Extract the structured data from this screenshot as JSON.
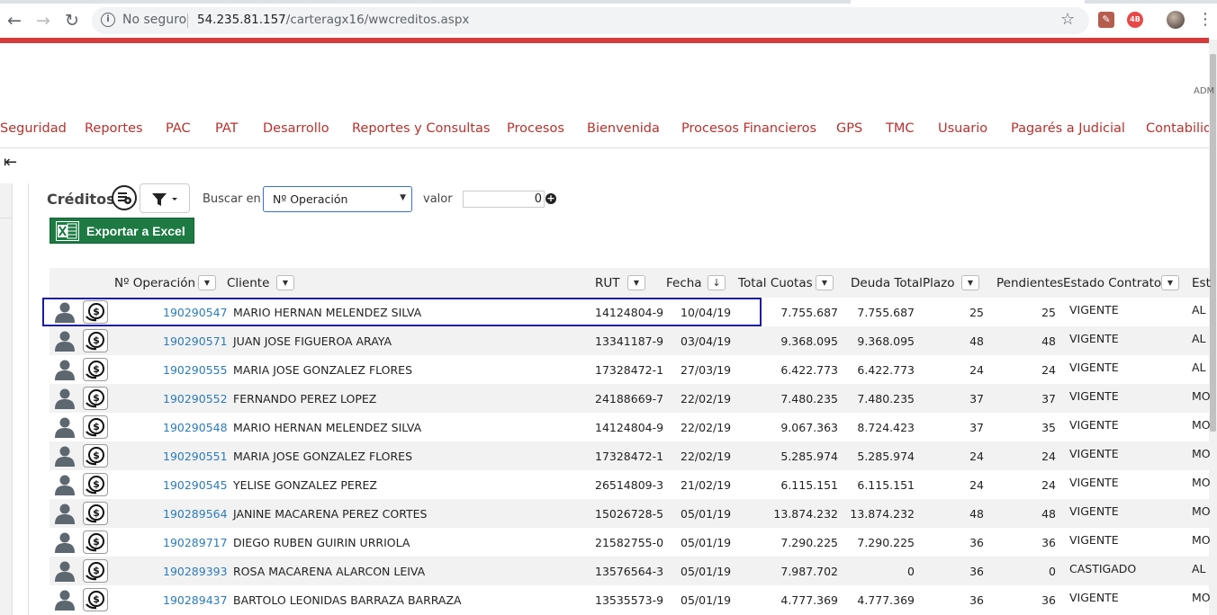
{
  "browser": {
    "insecure_label": "No seguro",
    "url_host": "54.235.81.157",
    "url_path": "/carteragx16/wwcreditos.aspx",
    "ext_badge": "4B"
  },
  "header": {
    "user_label": "ADM"
  },
  "menu": [
    "Seguridad",
    "Reportes",
    "PAC",
    "PAT",
    "Desarrollo",
    "Reportes y Consultas",
    "Procesos",
    "Bienvenida",
    "Procesos Financieros",
    "GPS",
    "TMC",
    "Usuario",
    "Pagarés a Judicial",
    "Contabilid"
  ],
  "toolbar": {
    "title": "Créditos",
    "buscar_label": "Buscar en",
    "buscar_selected": "Nº Operación",
    "valor_label": "valor",
    "valor_value": "0",
    "excel_label": "Exportar a Excel"
  },
  "table": {
    "headers": {
      "operacion": "Nº Operación",
      "cliente": "Cliente",
      "rut": "RUT",
      "fecha": "Fecha",
      "total_cuotas": "Total Cuotas",
      "deuda_total": "Deuda Total",
      "plazo": "Plazo",
      "pendientes": "Pendientes",
      "estado": "Estado Contrato",
      "est": "Est"
    },
    "rows": [
      {
        "op": "190290547",
        "cliente": "MARIO HERNAN MELENDEZ SILVA",
        "rut": "14124804-9",
        "fecha": "10/04/19",
        "total": "7.755.687",
        "deuda": "7.755.687",
        "plazo": "25",
        "pend": "25",
        "estado": "VIGENTE",
        "est": "AL"
      },
      {
        "op": "190290571",
        "cliente": "JUAN JOSE FIGUEROA ARAYA",
        "rut": "13341187-9",
        "fecha": "03/04/19",
        "total": "9.368.095",
        "deuda": "9.368.095",
        "plazo": "48",
        "pend": "48",
        "estado": "VIGENTE",
        "est": "AL"
      },
      {
        "op": "190290555",
        "cliente": "MARIA JOSE GONZALEZ FLORES",
        "rut": "17328472-1",
        "fecha": "27/03/19",
        "total": "6.422.773",
        "deuda": "6.422.773",
        "plazo": "24",
        "pend": "24",
        "estado": "VIGENTE",
        "est": "AL"
      },
      {
        "op": "190290552",
        "cliente": "FERNANDO PEREZ LOPEZ",
        "rut": "24188669-7",
        "fecha": "22/02/19",
        "total": "7.480.235",
        "deuda": "7.480.235",
        "plazo": "37",
        "pend": "37",
        "estado": "VIGENTE",
        "est": "MO"
      },
      {
        "op": "190290548",
        "cliente": "MARIO HERNAN MELENDEZ SILVA",
        "rut": "14124804-9",
        "fecha": "22/02/19",
        "total": "9.067.363",
        "deuda": "8.724.423",
        "plazo": "37",
        "pend": "35",
        "estado": "VIGENTE",
        "est": "MO"
      },
      {
        "op": "190290551",
        "cliente": "MARIA JOSE GONZALEZ FLORES",
        "rut": "17328472-1",
        "fecha": "22/02/19",
        "total": "5.285.974",
        "deuda": "5.285.974",
        "plazo": "24",
        "pend": "24",
        "estado": "VIGENTE",
        "est": "MO"
      },
      {
        "op": "190290545",
        "cliente": "YELISE GONZALEZ PEREZ",
        "rut": "26514809-3",
        "fecha": "21/02/19",
        "total": "6.115.151",
        "deuda": "6.115.151",
        "plazo": "24",
        "pend": "24",
        "estado": "VIGENTE",
        "est": "MO"
      },
      {
        "op": "190289564",
        "cliente": "JANINE MACARENA PEREZ CORTES",
        "rut": "15026728-5",
        "fecha": "05/01/19",
        "total": "13.874.232",
        "deuda": "13.874.232",
        "plazo": "48",
        "pend": "48",
        "estado": "VIGENTE",
        "est": "MO"
      },
      {
        "op": "190289717",
        "cliente": "DIEGO RUBEN GUIRIN URRIOLA",
        "rut": "21582755-0",
        "fecha": "05/01/19",
        "total": "7.290.225",
        "deuda": "7.290.225",
        "plazo": "36",
        "pend": "36",
        "estado": "VIGENTE",
        "est": "MO"
      },
      {
        "op": "190289393",
        "cliente": "ROSA MACARENA ALARCON LEIVA",
        "rut": "13576564-3",
        "fecha": "05/01/19",
        "total": "7.987.702",
        "deuda": "0",
        "plazo": "36",
        "pend": "0",
        "estado": "CASTIGADO",
        "est": "AL"
      },
      {
        "op": "190289437",
        "cliente": "BARTOLO LEONIDAS BARRAZA BARRAZA",
        "rut": "13535573-9",
        "fecha": "05/01/19",
        "total": "4.777.369",
        "deuda": "4.777.369",
        "plazo": "36",
        "pend": "36",
        "estado": "VIGENTE",
        "est": "MO"
      }
    ]
  }
}
